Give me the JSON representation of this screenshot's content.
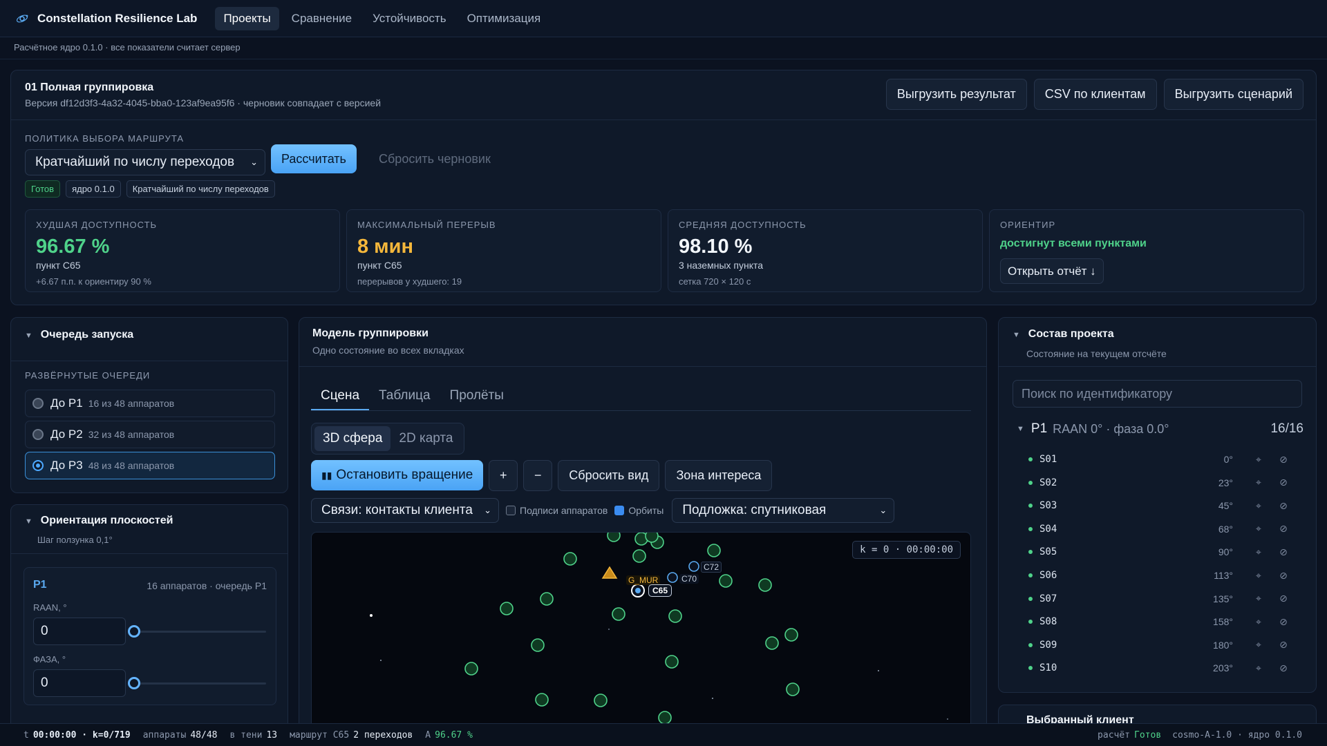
{
  "app": {
    "title": "Constellation Resilience Lab",
    "nav": [
      "Проекты",
      "Сравнение",
      "Устойчивость",
      "Оптимизация"
    ],
    "subline": "Расчётное ядро 0.1.0 · все показатели считает сервер"
  },
  "project": {
    "title": "01 Полная группировка",
    "version": "Версия df12d3f3-4a32-4045-bba0-123af9ea95f6 · черновик совпадает с версией",
    "buttons": {
      "export_result": "Выгрузить результат",
      "csv": "CSV по клиентам",
      "export_scenario": "Выгрузить сценарий"
    },
    "policy_label": "ПОЛИТИКА ВЫБОРА МАРШРУТА",
    "policy_value": "Кратчайший по числу переходов",
    "calc_button": "Рассчитать",
    "reset_button": "Сбросить черновик",
    "badges": [
      "Готов",
      "ядро 0.1.0",
      "Кратчайший по числу переходов"
    ]
  },
  "kpis": [
    {
      "label": "ХУДШАЯ ДОСТУПНОСТЬ",
      "value": "96.67 %",
      "sub1": "пункт C65",
      "sub2": "+6.67 п.п. к ориентиру 90 %",
      "color": "#4fd28a"
    },
    {
      "label": "МАКСИМАЛЬНЫЙ ПЕРЕРЫВ",
      "value": "8 мин",
      "sub1": "пункт C65",
      "sub2": "перерывов у худшего: 19",
      "color": "#f5b73b"
    },
    {
      "label": "СРЕДНЯЯ ДОСТУПНОСТЬ",
      "value": "98.10 %",
      "sub1": "3 наземных пункта",
      "sub2": "сетка 720 × 120 с",
      "color": "#f2f6fb"
    },
    {
      "label": "ОРИЕНТИР",
      "value": "достигнут всеми пунктами",
      "button": "Открыть отчёт ↓",
      "color": "#4fd28a"
    }
  ],
  "queue": {
    "title": "Очередь запуска",
    "section": "РАЗВЁРНУТЫЕ ОЧЕРЕДИ",
    "items": [
      {
        "name": "До P1",
        "count": "16 из 48 аппаратов"
      },
      {
        "name": "До P2",
        "count": "32 из 48 аппаратов"
      },
      {
        "name": "До P3",
        "count": "48 из 48 аппаратов"
      }
    ],
    "selected_index": 2
  },
  "orientation": {
    "title": "Ориентация плоскостей",
    "sub": "Шаг ползунка 0,1°",
    "plane": "P1",
    "plane_info": "16 аппаратов · очередь P1",
    "raan_label": "RAAN, °",
    "raan_value": "0",
    "phase_label": "ФАЗА, °",
    "phase_value": "0"
  },
  "model": {
    "title": "Модель группировки",
    "sub": "Одно состояние во всех вкладках",
    "tabs": [
      "Сцена",
      "Таблица",
      "Пролёты"
    ],
    "views": [
      "3D сфера",
      "2D карта"
    ],
    "stop_rotation": "Остановить вращение",
    "zoom_in": "+",
    "zoom_out": "−",
    "reset_view": "Сбросить вид",
    "roi": "Зона интереса",
    "links_select": "Связи: контакты клиента",
    "labels_check": "Подписи аппаратов",
    "orbits_check": "Орбиты",
    "basemap_select": "Подложка: спутниковая",
    "readout": "k = 0 · 00:00:00",
    "scene_labels": {
      "station": "G_MUR",
      "c65": "C65",
      "c70": "C70",
      "c72": "C72"
    }
  },
  "composition": {
    "title": "Состав проекта",
    "sub": "Состояние на текущем отсчёте",
    "search_placeholder": "Поиск по идентификатору",
    "plane_name": "P1",
    "plane_params": "RAAN 0° · фаза 0.0°",
    "plane_count": "16/16",
    "sats": [
      {
        "id": "S01",
        "angle": "0°"
      },
      {
        "id": "S02",
        "angle": "23°"
      },
      {
        "id": "S03",
        "angle": "45°"
      },
      {
        "id": "S04",
        "angle": "68°"
      },
      {
        "id": "S05",
        "angle": "90°"
      },
      {
        "id": "S06",
        "angle": "113°"
      },
      {
        "id": "S07",
        "angle": "135°"
      },
      {
        "id": "S08",
        "angle": "158°"
      },
      {
        "id": "S09",
        "angle": "180°"
      },
      {
        "id": "S10",
        "angle": "203°"
      }
    ],
    "next_panel": "Выбранный клиент"
  },
  "status": {
    "t_label": "t",
    "t_value": "00:00:00 · k=0/719",
    "sats_label": "аппараты",
    "sats_value": "48/48",
    "shadow_label": "в тени",
    "shadow_value": "13",
    "route_label": "маршрут C65",
    "route_value": "2 переходов",
    "a_label": "A",
    "a_value": "96.67 %",
    "calc_label": "расчёт",
    "calc_value": "Готов",
    "engine": "cosmo-A-1.0 · ядро 0.1.0"
  }
}
